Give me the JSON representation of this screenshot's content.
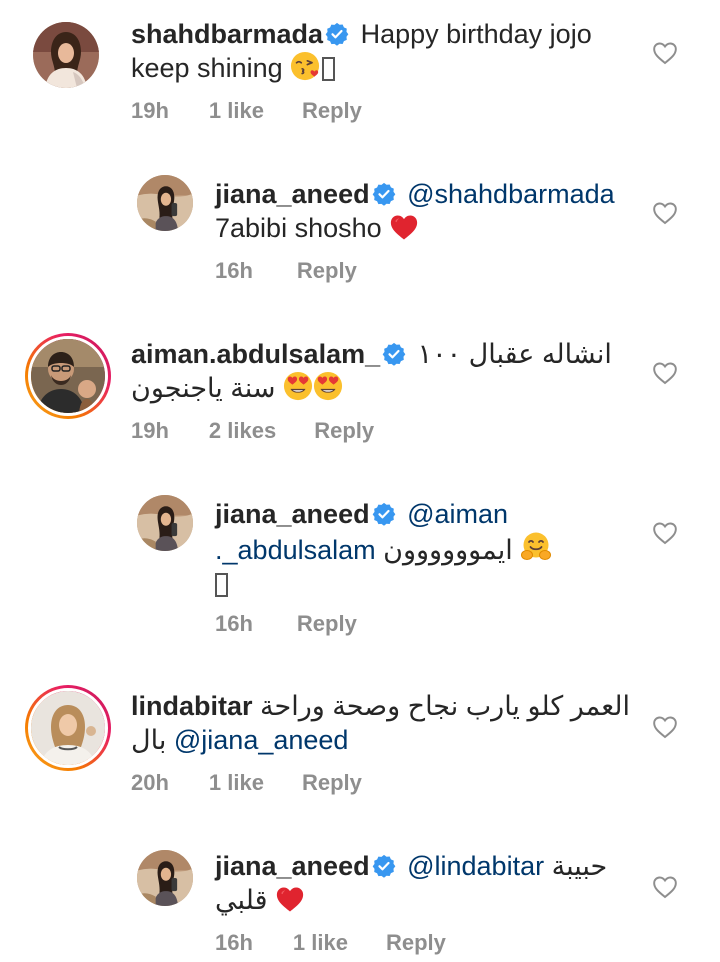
{
  "comments": [
    {
      "username": "shahdbarmada",
      "text_line1": "Happy birthday jojo",
      "text_line2": "keep shining",
      "time": "19h",
      "likes": "1 like",
      "reply": "Reply",
      "emoji": "face-blowing-kiss",
      "has_story_ring": false
    },
    {
      "username": "jiana_aneed",
      "mention": "@shahdbarmada",
      "text_line2": "7abibi shosho",
      "time": "16h",
      "reply": "Reply",
      "emoji": "red-heart",
      "has_story_ring": false
    },
    {
      "username": "aiman.abdulsalam_",
      "text_line1": "انشاله عقبال ١٠٠",
      "text_line2": "سنة ياجنجون",
      "time": "19h",
      "likes": "2 likes",
      "reply": "Reply",
      "emoji": "heart-eyes",
      "has_story_ring": true
    },
    {
      "username": "jiana_aneed",
      "mention": "@aiman",
      "mention_cont": "abdulsalam_.",
      "text_arabic": "ايموووووون",
      "time": "16h",
      "reply": "Reply",
      "emoji": "hugging-face",
      "has_story_ring": false
    },
    {
      "username": "lindabitar",
      "text_line1": "العمر كلو يارب نجاح وصحة وراحة",
      "text_line2_arabic": "بال",
      "mention": "@jiana_aneed",
      "time": "20h",
      "likes": "1 like",
      "reply": "Reply",
      "has_story_ring": true
    },
    {
      "username": "jiana_aneed",
      "mention": "@lindabitar",
      "text_arabic1": "حبيبة",
      "text_arabic2": "قلبي",
      "time": "16h",
      "likes": "1 like",
      "reply": "Reply",
      "emoji": "red-heart",
      "has_story_ring": false
    }
  ],
  "icons": {
    "verified": "verified-badge-icon",
    "like": "heart-outline-icon"
  },
  "colors": {
    "verified_blue": "#3897f0",
    "mention_blue": "#00376b",
    "meta_gray": "#8e8e8e",
    "heart_red": "#ed4956"
  }
}
